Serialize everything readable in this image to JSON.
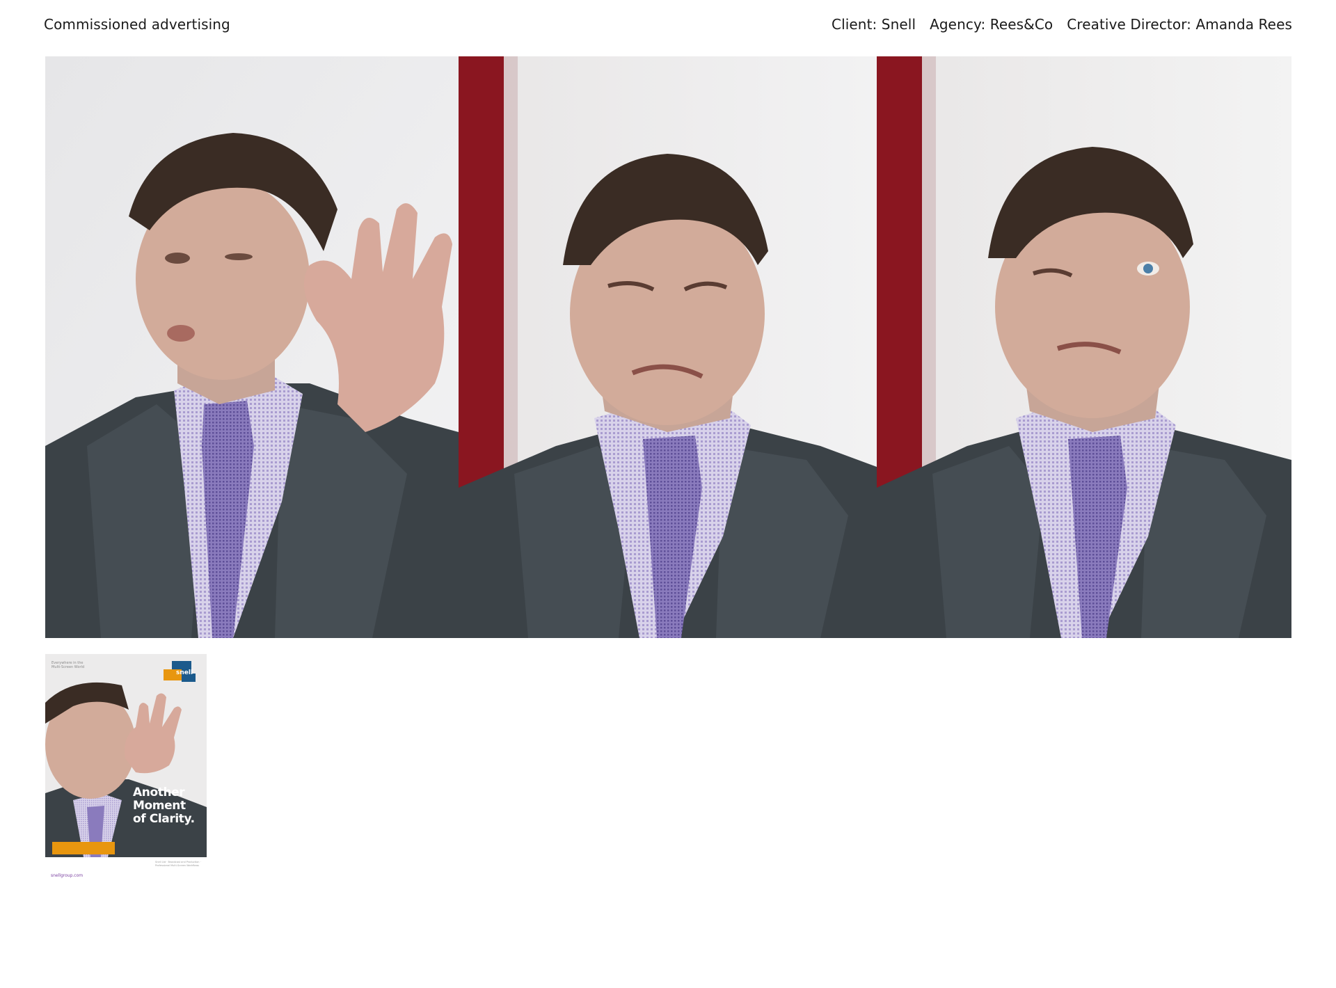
{
  "header": {
    "title": "Commissioned advertising",
    "client": "Client: Snell",
    "agency": "Agency: Rees&Co",
    "creative_director": "Creative Director: Amanda Rees"
  },
  "main_photos": [
    {
      "name": "portrait-hand-raised"
    },
    {
      "name": "portrait-squint"
    },
    {
      "name": "portrait-wink"
    }
  ],
  "poster": {
    "kicker": "Everywhere in the Multi-Screen World",
    "logo": "snell",
    "headline_lines": [
      "Another",
      "Moment",
      "of Clarity."
    ],
    "url": "snellgroup.com",
    "footnote": "Snell Ltd · Broadcast and Production · Professional Multi-Screen Workflows"
  },
  "colors": {
    "suit": "#3b4247",
    "tie": "#8878b8",
    "shirt": "#d9d4ea",
    "red_backdrop": "#8a1620",
    "poster_orange": "#e8960f",
    "logo_blue": "#1b5a8c"
  }
}
